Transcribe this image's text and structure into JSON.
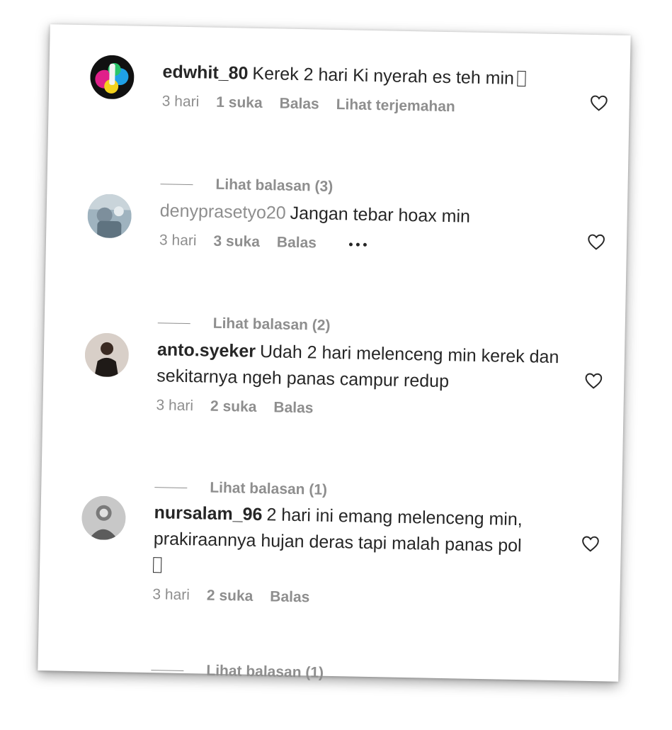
{
  "comments": [
    {
      "username": "edwhit_80",
      "text": "Kerek 2 hari Ki nyerah es teh min",
      "time": "3 hari",
      "likes": "1 suka",
      "reply": "Balas",
      "translate": "Lihat terjemahan",
      "replies": "Lihat balasan (3)"
    },
    {
      "username": "denyprasetyo20",
      "text": "Jangan tebar hoax min",
      "time": "3 hari",
      "likes": "3 suka",
      "reply": "Balas",
      "replies": "Lihat balasan (2)"
    },
    {
      "username": "anto.syeker",
      "text": "Udah 2 hari melenceng min kerek dan sekitarnya ngeh panas campur redup",
      "time": "3 hari",
      "likes": "2 suka",
      "reply": "Balas",
      "replies": "Lihat balasan (1)"
    },
    {
      "username": "nursalam_96",
      "text": "2 hari ini emang melenceng min, prakiraannya hujan deras tapi malah panas pol",
      "time": "3 hari",
      "likes": "2 suka",
      "reply": "Balas",
      "replies": "Lihat balasan (1)"
    }
  ],
  "icons": {
    "like": "heart-outline-icon",
    "more": "more-options-icon",
    "emoji_placeholder": "missing-emoji-glyph"
  },
  "colors": {
    "text": "#262626",
    "secondary": "#8e8e8e",
    "background": "#ffffff"
  }
}
